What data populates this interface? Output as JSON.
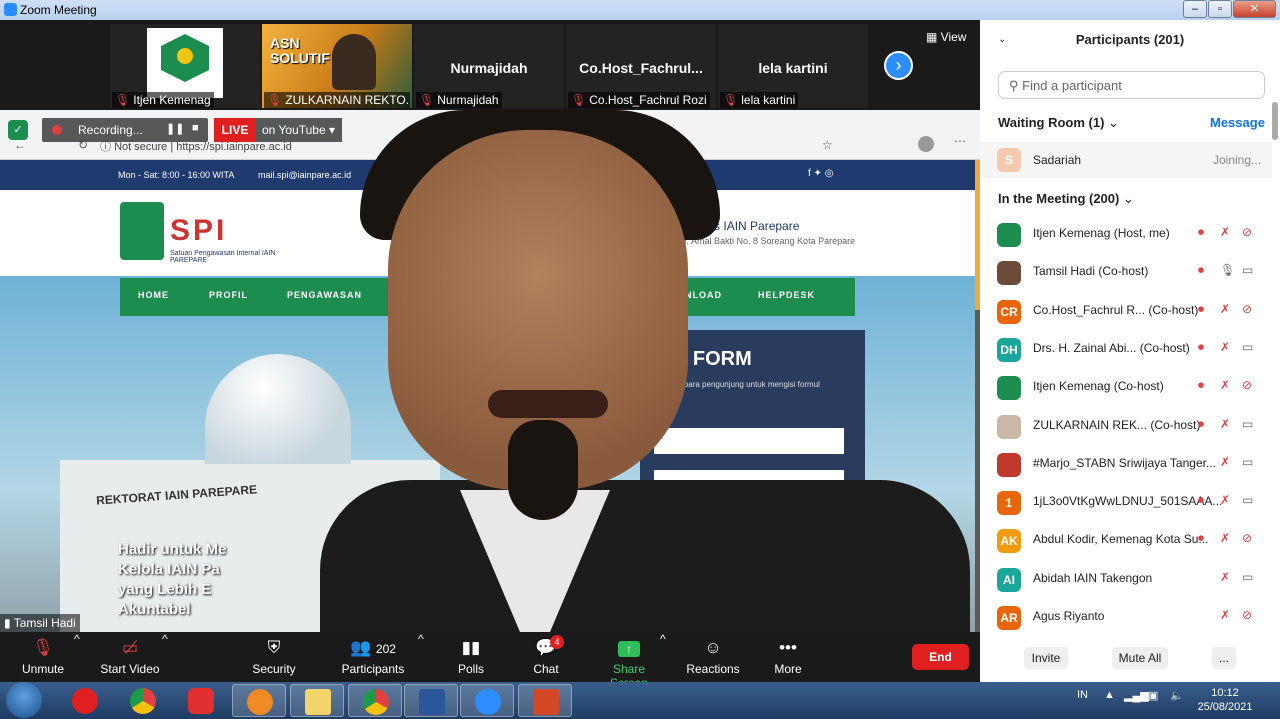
{
  "window": {
    "title": "Zoom Meeting"
  },
  "thumbnails": [
    {
      "display": "",
      "label": "Itjen Kemenag"
    },
    {
      "display": "",
      "label": "ZULKARNAIN REKTO..."
    },
    {
      "display": "Nurmajidah",
      "label": "Nurmajidah"
    },
    {
      "display": "Co.Host_Fachrul...",
      "label": "Co.Host_Fachrul Rozi"
    },
    {
      "display": "lela kartini",
      "label": "lela kartini"
    }
  ],
  "thumb_poster_text": {
    "line1": "ASN",
    "line2": "SOLUTIF"
  },
  "view_label": "View",
  "recording": {
    "label": "Recording...",
    "live": "LIVE",
    "youtube": "on YouTube"
  },
  "website": {
    "url_secure": "Not secure",
    "url": "https://spi.iainpare.ac.id",
    "topbar_hours": "Mon - Sat: 8:00 - 16:00 WITA",
    "topbar_mail": "mail.spi@iainpare.ac.id",
    "logo_text": "SPI",
    "logo_sub": "Satuan Pengawasan Internal IAIN PAREPARE",
    "campus": "Kampus IAIN Parepare",
    "campus_addr": "Jl. Amal Bakti No. 8 Soreang Kota Parepare",
    "nav": [
      "HOME",
      "PROFIL",
      "PENGAWASAN",
      "DOWNLOAD",
      "HELPDESK"
    ],
    "building_sign": "REKTORAT IAIN PAREPARE",
    "hero_lines": [
      "Hadir untuk Me",
      "Kelola IAIN Pa",
      "yang Lebih E",
      "Akuntabel"
    ],
    "form_title": "S FORM",
    "form_sub": "Kepada para pengunjung untuk mengisi formul"
  },
  "speaker": {
    "name": "Tamsil Hadi"
  },
  "toolbar": {
    "unmute": "Unmute",
    "start_video": "Start Video",
    "security": "Security",
    "participants": "Participants",
    "participants_count": "202",
    "polls": "Polls",
    "chat": "Chat",
    "chat_badge": "4",
    "share_screen": "Share Screen",
    "reactions": "Reactions",
    "more": "More",
    "end": "End"
  },
  "panel": {
    "title": "Participants (201)",
    "search_placeholder": "Find a participant",
    "waiting_room": "Waiting Room (1)",
    "message": "Message",
    "waiting_person": {
      "initial": "S",
      "name": "Sadariah",
      "status": "Joining..."
    },
    "in_meeting": "In the Meeting (200)",
    "participants": [
      {
        "initial": "",
        "color": "#1d8c4f",
        "name": "Itjen Kemenag (Host, me)"
      },
      {
        "initial": "",
        "color": "#6b4c3b",
        "name": "Tamsil Hadi (Co-host)"
      },
      {
        "initial": "CR",
        "color": "#e8650a",
        "name": "Co.Host_Fachrul R... (Co-host)"
      },
      {
        "initial": "DH",
        "color": "#1aa69a",
        "name": "Drs. H. Zainal Abi... (Co-host)"
      },
      {
        "initial": "",
        "color": "#1d8c4f",
        "name": "Itjen Kemenag (Co-host)"
      },
      {
        "initial": "",
        "color": "#c9b8a6",
        "name": "ZULKARNAIN REK... (Co-host)"
      },
      {
        "initial": "",
        "color": "#c0392b",
        "name": "#Marjo_STABN Sriwijaya Tanger..."
      },
      {
        "initial": "1",
        "color": "#e8650a",
        "name": "1jL3o0VtKgWwLDNUJ_501SAAA..."
      },
      {
        "initial": "AK",
        "color": "#f39c12",
        "name": "Abdul Kodir, Kemenag Kota Su..."
      },
      {
        "initial": "AI",
        "color": "#1aa69a",
        "name": "Abidah IAIN Takengon"
      },
      {
        "initial": "AR",
        "color": "#e8650a",
        "name": "Agus Riyanto"
      }
    ],
    "invite": "Invite",
    "mute_all": "Mute All",
    "more": "..."
  },
  "taskbar": {
    "lang": "IN",
    "time": "10:12",
    "date": "25/08/2021"
  }
}
